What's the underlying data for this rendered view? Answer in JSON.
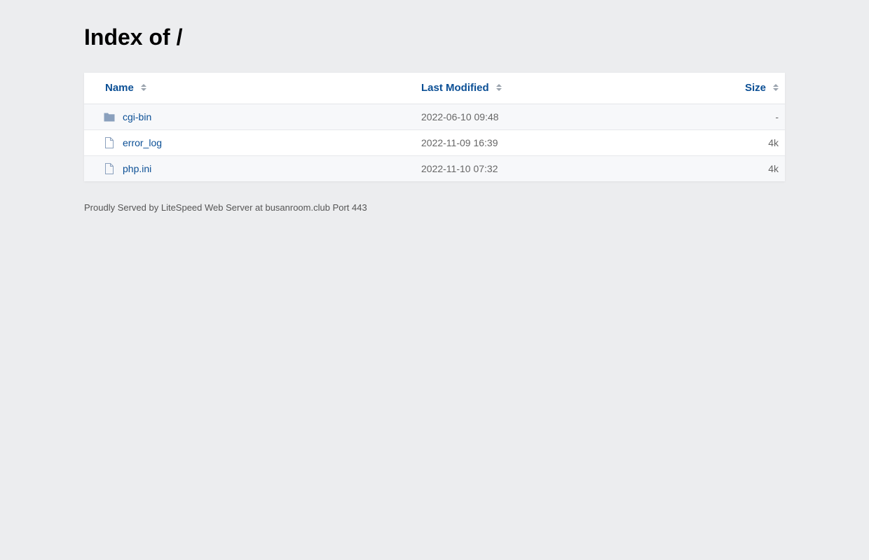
{
  "page": {
    "title": "Index of /"
  },
  "table": {
    "columns": {
      "name": "Name",
      "last_modified": "Last Modified",
      "size": "Size"
    },
    "rows": [
      {
        "icon": "folder-icon",
        "name": "cgi-bin",
        "last_modified": "2022-06-10 09:48",
        "size": "-"
      },
      {
        "icon": "file-icon",
        "name": "error_log",
        "last_modified": "2022-11-09 16:39",
        "size": "4k"
      },
      {
        "icon": "file-icon",
        "name": "php.ini",
        "last_modified": "2022-11-10 07:32",
        "size": "4k"
      }
    ]
  },
  "footer": {
    "text": "Proudly Served by LiteSpeed Web Server at busanroom.club Port 443"
  },
  "colors": {
    "background": "#ecedef",
    "link": "#0b4f95",
    "icon": "#8aa0bd"
  }
}
